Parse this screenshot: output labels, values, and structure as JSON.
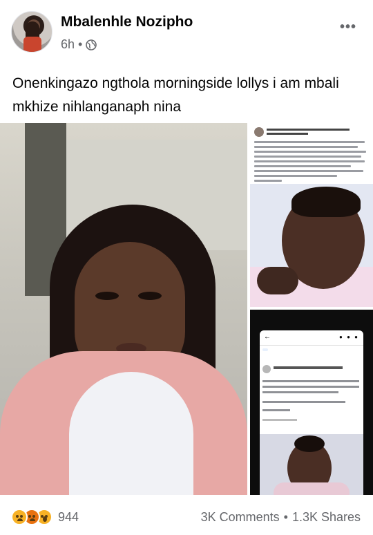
{
  "post": {
    "author": "Mbalenhle Nozipho",
    "time": "6h",
    "separator": "•",
    "audience_icon": "globe-icon",
    "more_icon": "more-dots-icon",
    "text": "Onenkingazo ngthola morningside lollys i am mbali mkhize nihlanganaph nina"
  },
  "media": {
    "main_photo": "photo of young woman",
    "top_right_photo": "screenshot of facebook post with crying baby",
    "bottom_right_photo": "phone screenshot of groups post with baby"
  },
  "footer": {
    "reactions": [
      "sad",
      "angry",
      "wow"
    ],
    "reaction_count": "944",
    "comments": "3K Comments",
    "dot": "•",
    "shares": "1.3K Shares"
  }
}
